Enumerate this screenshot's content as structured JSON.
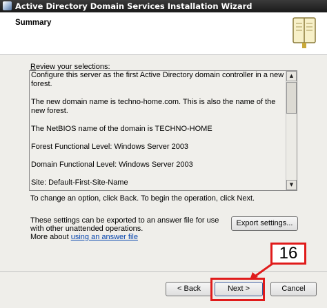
{
  "window": {
    "title": "Active Directory Domain Services Installation Wizard"
  },
  "header": {
    "title": "Summary"
  },
  "review": {
    "label": "Review your selections:",
    "lines": [
      "Configure this server as the first Active Directory domain controller in a new forest.",
      "The new domain name is techno-home.com. This is also the name of the new forest.",
      "The NetBIOS name of the domain is TECHNO-HOME",
      "Forest Functional Level: Windows Server 2003",
      "Domain Functional Level: Windows Server 2003",
      "Site: Default-First-Site-Name"
    ]
  },
  "hints": {
    "change": "To change an option, click Back. To begin the operation, click Next.",
    "export": "These settings can be exported to an answer file for use with other unattended operations.",
    "more_about_prefix": "More about",
    "more_about_link": "using an answer file"
  },
  "buttons": {
    "export": "Export settings...",
    "back": "< Back",
    "next": "Next >",
    "cancel": "Cancel"
  },
  "annotation": {
    "step": "16",
    "color": "#e01b1b"
  }
}
